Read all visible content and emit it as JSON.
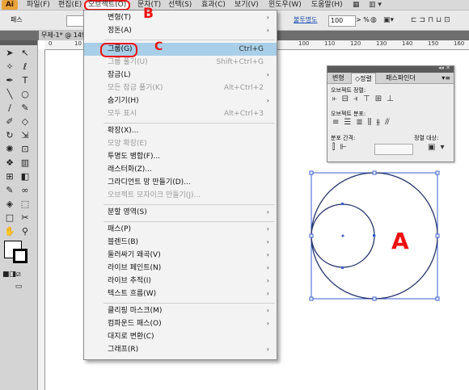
{
  "app": {
    "logo": "Ai"
  },
  "menubar": {
    "file": "파일(F)",
    "edit": "편집(E)",
    "object": "오브젝트(O)",
    "type": "문자(T)",
    "select": "선택(S)",
    "effect": "효과(C)",
    "view": "보기(V)",
    "window": "윈도우(W)",
    "help": "도움말(H)"
  },
  "controlbar": {
    "path_label": "패스",
    "stroke_label": "■",
    "opacity_link": "불투명도",
    "opacity_value": "100",
    "opacity_unit": "> %"
  },
  "document": {
    "tab_title": "무제-1* @ 149"
  },
  "rulers": {
    "h_left": [
      "0",
      "10"
    ],
    "h_right": [
      "100",
      "110",
      "120",
      "130",
      "140",
      "150",
      "160",
      "170"
    ]
  },
  "dropdown": {
    "items": [
      {
        "label": "변형(T)",
        "shortcut": "",
        "submenu": true,
        "disabled": false
      },
      {
        "label": "정돈(A)",
        "shortcut": "",
        "submenu": true,
        "disabled": false
      },
      {
        "label": "그룹(G)",
        "shortcut": "Ctrl+G",
        "submenu": false,
        "disabled": false,
        "highlighted": true
      },
      {
        "label": "그룹 풀기(U)",
        "shortcut": "Shift+Ctrl+G",
        "submenu": false,
        "disabled": true
      },
      {
        "label": "잠금(L)",
        "shortcut": "",
        "submenu": true,
        "disabled": false
      },
      {
        "label": "모든 잠금 풀기(K)",
        "shortcut": "Alt+Ctrl+2",
        "submenu": false,
        "disabled": true
      },
      {
        "label": "숨기기(H)",
        "shortcut": "",
        "submenu": true,
        "disabled": false
      },
      {
        "label": "모두 표시",
        "shortcut": "Alt+Ctrl+3",
        "submenu": false,
        "disabled": true
      },
      {
        "label": "확장(X)...",
        "shortcut": "",
        "submenu": false,
        "disabled": false
      },
      {
        "label": "모양 확장(E)",
        "shortcut": "",
        "submenu": false,
        "disabled": true
      },
      {
        "label": "투명도 병합(F)...",
        "shortcut": "",
        "submenu": false,
        "disabled": false
      },
      {
        "label": "래스터화(Z)...",
        "shortcut": "",
        "submenu": false,
        "disabled": false
      },
      {
        "label": "그라디언트 망 만들기(D)...",
        "shortcut": "",
        "submenu": false,
        "disabled": false
      },
      {
        "label": "오브젝트 모자이크 만들기(J)...",
        "shortcut": "",
        "submenu": false,
        "disabled": true
      },
      {
        "label": "분할 영역(S)",
        "shortcut": "",
        "submenu": true,
        "disabled": false
      },
      {
        "label": "패스(P)",
        "shortcut": "",
        "submenu": true,
        "disabled": false
      },
      {
        "label": "블렌드(B)",
        "shortcut": "",
        "submenu": true,
        "disabled": false
      },
      {
        "label": "둘러싸기 왜곡(V)",
        "shortcut": "",
        "submenu": true,
        "disabled": false
      },
      {
        "label": "라이브 페인트(N)",
        "shortcut": "",
        "submenu": true,
        "disabled": false
      },
      {
        "label": "라이브 추적(I)",
        "shortcut": "",
        "submenu": true,
        "disabled": false
      },
      {
        "label": "텍스트 흐름(W)",
        "shortcut": "",
        "submenu": true,
        "disabled": false
      },
      {
        "label": "클리핑 마스크(M)",
        "shortcut": "",
        "submenu": true,
        "disabled": false
      },
      {
        "label": "컴파운드 패스(O)",
        "shortcut": "",
        "submenu": true,
        "disabled": false
      },
      {
        "label": "대지로 변환(C)",
        "shortcut": "",
        "submenu": false,
        "disabled": false
      },
      {
        "label": "그래프(R)",
        "shortcut": "",
        "submenu": true,
        "disabled": false
      }
    ]
  },
  "alignpanel": {
    "tabs": [
      "변형",
      "◇정렬",
      "패스파인더"
    ],
    "align_objects": "오브젝트 정렬:",
    "distribute_objects": "오브젝트 분포:",
    "distribute_spacing": "분포 간격:",
    "align_to": "정렬 대상:"
  },
  "annotations": {
    "b_mark": "B",
    "c_mark": "C",
    "a_mark": "A",
    "color": "#e11111"
  },
  "colors": {
    "selection": "#3a5fcd",
    "menu_highlight": "#a9cfe8",
    "ui_gray": "#d4d4d4"
  }
}
